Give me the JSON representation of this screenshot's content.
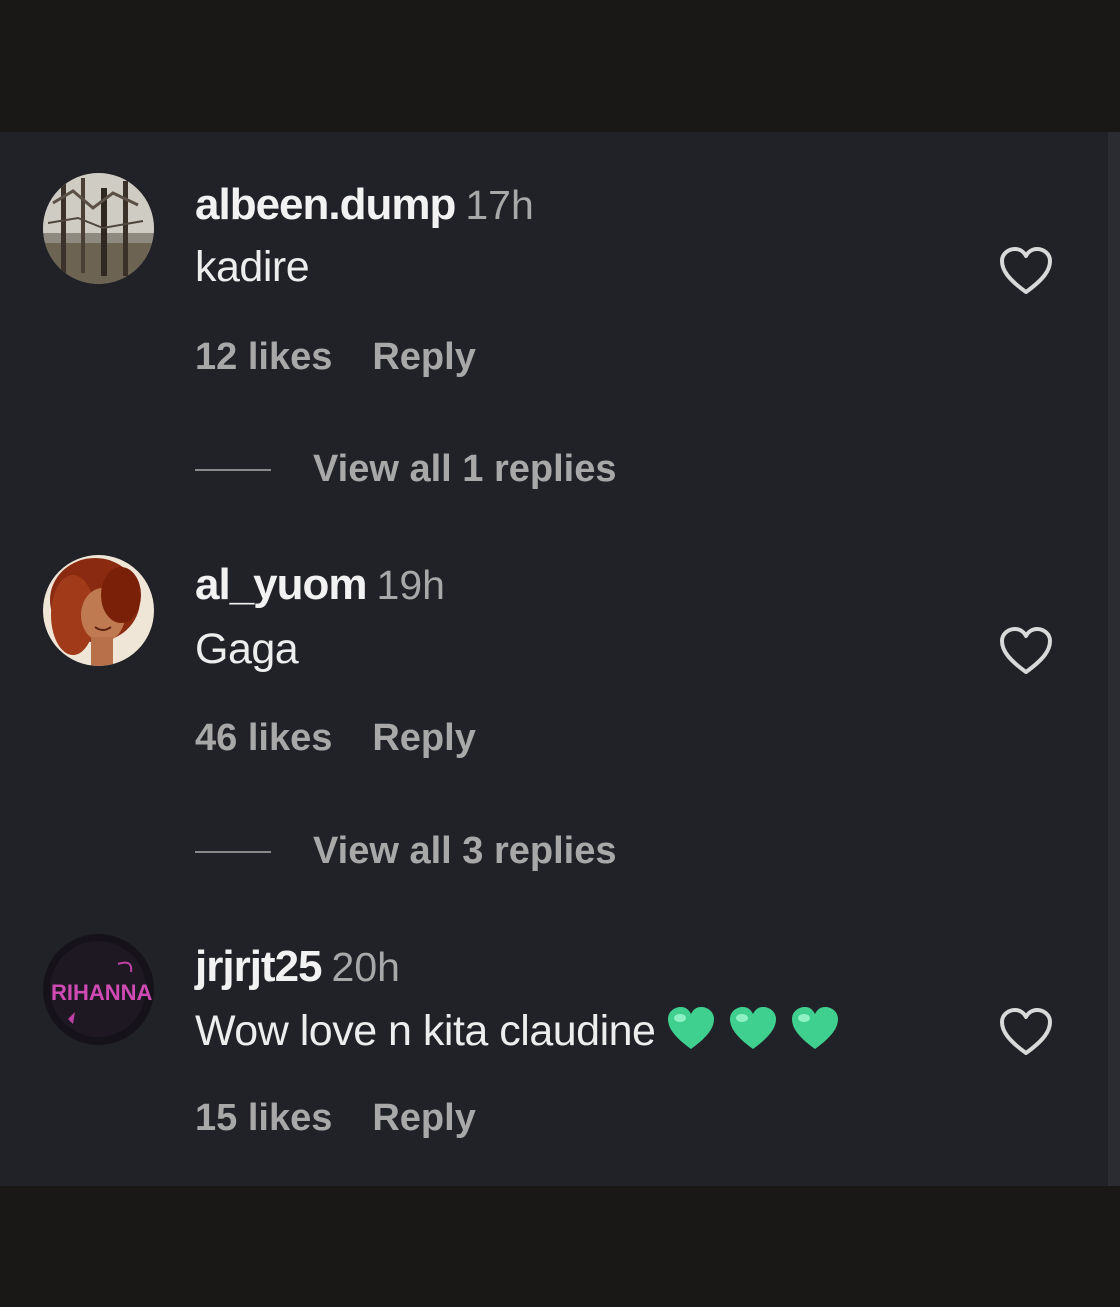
{
  "colors": {
    "panel": "#202227",
    "username": "#f2f2f2",
    "muted": "#a8a8a8",
    "green_heart": "#3fd08f"
  },
  "comments": [
    {
      "username": "albeen.dump",
      "time": "17h",
      "text": "kadire",
      "likes": "12 likes",
      "reply_label": "Reply",
      "view_replies": "View all 1 replies",
      "avatar": "trees-photo"
    },
    {
      "username": "al_yuom",
      "time": "19h",
      "text": "Gaga",
      "likes": "46 likes",
      "reply_label": "Reply",
      "view_replies": "View all 3 replies",
      "avatar": "woman-photo"
    },
    {
      "username": "jrjrjt25",
      "time": "20h",
      "text": "Wow love n kita claudine",
      "emojis": [
        "green-heart-emoji",
        "green-heart-emoji",
        "green-heart-emoji"
      ],
      "likes": "15 likes",
      "reply_label": "Reply",
      "avatar": "rihanna-logo",
      "avatar_text": "RIHANNA"
    }
  ]
}
